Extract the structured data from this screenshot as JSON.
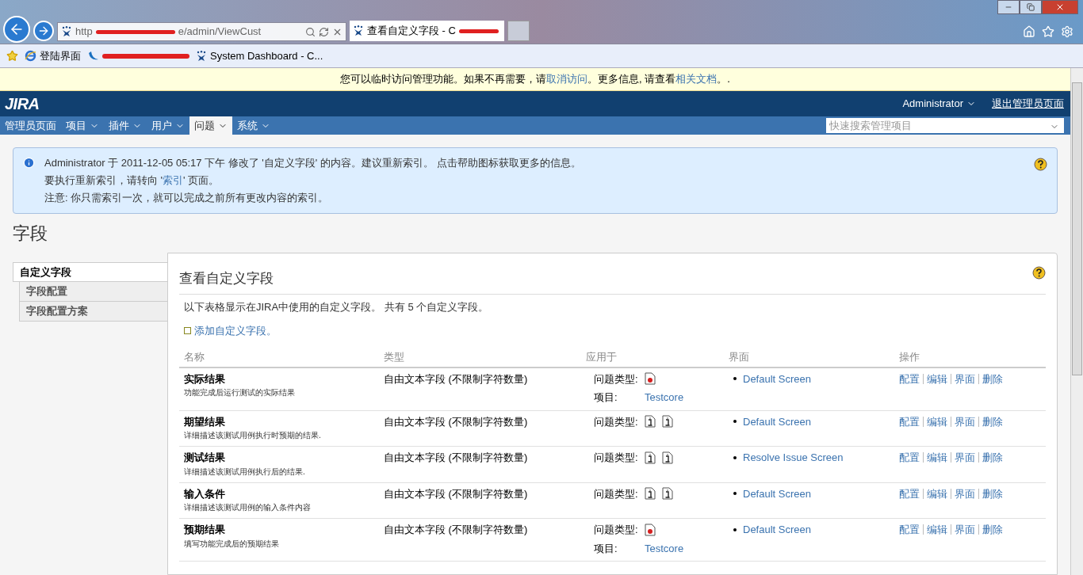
{
  "browser": {
    "address_start": "http",
    "address_end": "e/admin/ViewCust",
    "tab_title": "查看自定义字段 - C",
    "bookmarks": [
      {
        "kind": "ie",
        "label": "登陆界面"
      },
      {
        "kind": "redacted"
      },
      {
        "kind": "jira",
        "label": "System Dashboard - C..."
      }
    ]
  },
  "banner": {
    "text": "您可以临时访问管理功能。如果不再需要，请 ",
    "link1": "取消访问",
    "middle": "。更多信息, 请查看 ",
    "link2": "相关文档",
    "end": "。."
  },
  "header": {
    "logo": "JIRA",
    "user": "Administrator",
    "exit": "退出管理员页面"
  },
  "nav": {
    "items": [
      {
        "label": "管理员页面",
        "dropdown": false,
        "selected": false
      },
      {
        "label": "项目",
        "dropdown": true,
        "selected": false
      },
      {
        "label": "插件",
        "dropdown": true,
        "selected": false
      },
      {
        "label": "用户",
        "dropdown": true,
        "selected": false
      },
      {
        "label": "问题",
        "dropdown": true,
        "selected": true
      },
      {
        "label": "系统",
        "dropdown": true,
        "selected": false
      }
    ],
    "search_placeholder": "快速搜索管理项目"
  },
  "notice": {
    "line1": "Administrator 于 2011-12-05 05:17 下午 修改了 '自定义字段' 的内容。建议重新索引。 点击帮助图标获取更多的信息。",
    "line2_before": "要执行重新索引，请转向 '",
    "line2_link": "索引",
    "line2_after": "' 页面。",
    "line3": "注意: 你只需索引一次，就可以完成之前所有更改内容的索引。"
  },
  "page_title": "字段",
  "sidebar": {
    "items": [
      {
        "label": "自定义字段",
        "selected": true
      },
      {
        "label": "字段配置",
        "selected": false
      },
      {
        "label": "字段配置方案",
        "selected": false
      }
    ]
  },
  "panel": {
    "title": "查看自定义字段",
    "description": "以下表格显示在JIRA中使用的自定义字段。 共有 5 个自定义字段。",
    "add_link": "添加自定义字段。",
    "columns": [
      "名称",
      "类型",
      "应用于",
      "界面",
      "操作"
    ],
    "rows": [
      {
        "name": "实际结果",
        "description": "功能完成后运行测试的实际结果",
        "type": "自由文本字段 (不限制字符数量)",
        "issue_type_label": "问题类型:",
        "issue_types": [
          {
            "kind": "bug"
          }
        ],
        "project_label": "项目:",
        "project": "Testcore",
        "screen": "Default Screen",
        "actions": [
          "配置",
          "编辑",
          "界面",
          "删除"
        ]
      },
      {
        "name": "期望结果",
        "description": "详细描述该测试用例执行时预期的结果.",
        "type": "自由文本字段 (不限制字符数量)",
        "issue_type_label": "问题类型:",
        "issue_types": [
          {
            "kind": "info"
          },
          {
            "kind": "info"
          }
        ],
        "screen": "Default Screen",
        "actions": [
          "配置",
          "编辑",
          "界面",
          "删除"
        ]
      },
      {
        "name": "测试结果",
        "description": "详细描述该测试用例执行后的结果.",
        "type": "自由文本字段 (不限制字符数量)",
        "issue_type_label": "问题类型:",
        "issue_types": [
          {
            "kind": "info"
          },
          {
            "kind": "info"
          }
        ],
        "screen": "Resolve Issue Screen",
        "actions": [
          "配置",
          "编辑",
          "界面",
          "删除"
        ]
      },
      {
        "name": "输入条件",
        "description": "详细描述该测试用例的输入条件内容",
        "type": "自由文本字段 (不限制字符数量)",
        "issue_type_label": "问题类型:",
        "issue_types": [
          {
            "kind": "info"
          },
          {
            "kind": "info"
          }
        ],
        "screen": "Default Screen",
        "actions": [
          "配置",
          "编辑",
          "界面",
          "删除"
        ]
      },
      {
        "name": "预期结果",
        "description": "填写功能完成后的预期结果",
        "type": "自由文本字段 (不限制字符数量)",
        "issue_type_label": "问题类型:",
        "issue_types": [
          {
            "kind": "bug"
          }
        ],
        "project_label": "项目:",
        "project": "Testcore",
        "screen": "Default Screen",
        "actions": [
          "配置",
          "编辑",
          "界面",
          "删除"
        ]
      }
    ]
  }
}
